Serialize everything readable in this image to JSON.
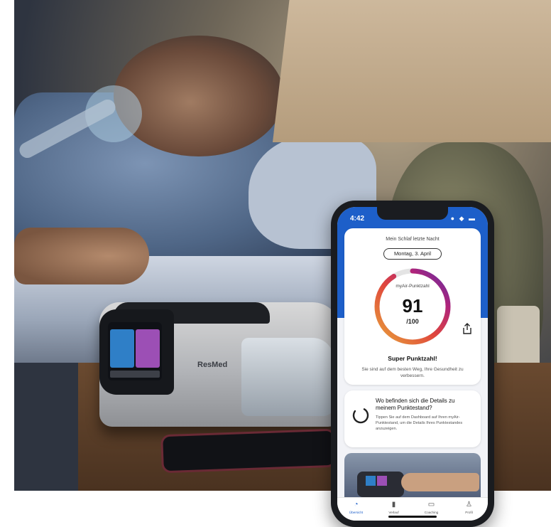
{
  "phone": {
    "status_time": "4:42",
    "status_icons": "● ◆ ▬",
    "caption": "Mein Schlaf letzte Nacht",
    "date": "Montag, 3. April",
    "score_label": "myAir-Punktzahl",
    "score_value": "91",
    "score_max": "/100",
    "headline": "Super Punktzahl!",
    "subline": "Sie sind auf dem besten Weg, Ihre Gesundheit zu verbessern.",
    "info_title": "Wo befinden sich die Details zu meinem Punktestand?",
    "info_body": "Tippen Sie auf dem Dashboard auf Ihren myAir-Punktestand, um die Details Ihres Punktestandes anzuzeigen.",
    "score_fraction": 0.91,
    "tabs": [
      {
        "label": "Übersicht",
        "icon": "overview-icon",
        "active": true
      },
      {
        "label": "Verlauf",
        "icon": "history-icon",
        "active": false
      },
      {
        "label": "Coaching",
        "icon": "chat-icon",
        "active": false
      },
      {
        "label": "Profil",
        "icon": "profile-icon",
        "active": false
      }
    ],
    "accent_color": "#1d5fc9"
  },
  "device": {
    "brand": "ResMed"
  }
}
